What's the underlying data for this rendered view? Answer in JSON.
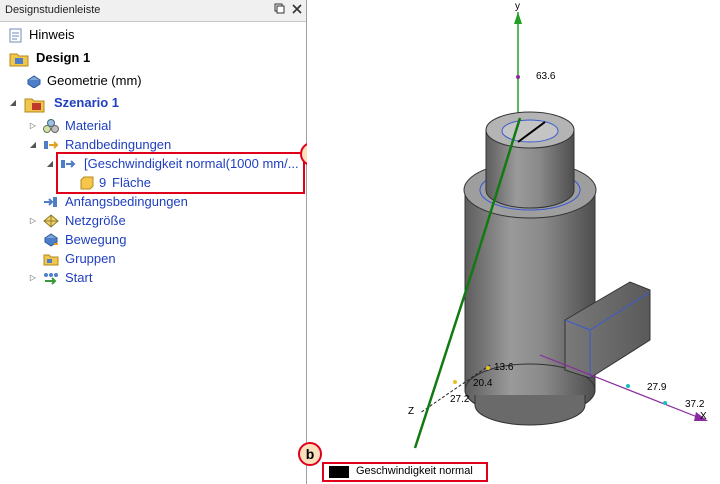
{
  "panel": {
    "title": "Designstudienleiste",
    "pin_icon": "pin-icon",
    "close_icon": "close-icon"
  },
  "tree": {
    "hint": "Hinweis",
    "design": "Design 1",
    "geometry": "Geometrie (mm)",
    "scenario": "Szenario 1",
    "material": "Material",
    "boundary": "Randbedingungen",
    "boundary_item": "[Geschwindigkeit normal(1000 mm/...",
    "face_count": "9",
    "face_label": "Fläche",
    "initial": "Anfangsbedingungen",
    "mesh": "Netzgröße",
    "motion": "Bewegung",
    "groups": "Gruppen",
    "start": "Start"
  },
  "callouts": {
    "a": "a",
    "b": "b"
  },
  "viewport": {
    "axis_y": "y",
    "axis_z": "Z",
    "axis_x": "X",
    "y_value": "63.6",
    "z_value1": "13.6",
    "z_value2": "20.4",
    "z_value3": "27.2",
    "x_value1": "27.9",
    "x_value2": "37.2",
    "legend_label": "Geschwindigkeit normal",
    "legend_color": "#000000"
  }
}
